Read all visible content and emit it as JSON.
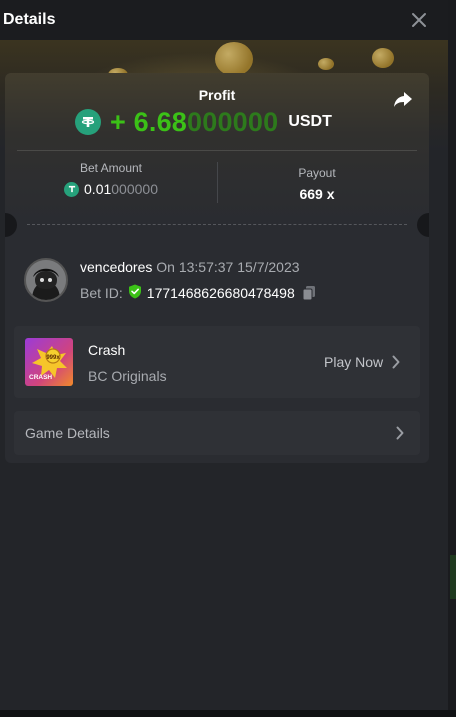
{
  "header": {
    "title": "Details"
  },
  "profit": {
    "label": "Profit",
    "sign": "+ ",
    "value_main": "6.68",
    "value_trailing": "000000",
    "currency": "USDT"
  },
  "bet": {
    "label": "Bet Amount",
    "value_main": "0.01",
    "value_trailing": "000000"
  },
  "payout": {
    "label": "Payout",
    "value": "669 x"
  },
  "user": {
    "name": "vencedores",
    "date": " On 13:57:37 15/7/2023",
    "bet_id_label": "Bet ID:",
    "bet_id": "1771468626680478498"
  },
  "game": {
    "name": "Crash",
    "provider": "BC Originals",
    "play_label": "Play Now",
    "thumb_caption": "CRASH"
  },
  "game_details": {
    "label": "Game Details"
  },
  "colors": {
    "profit_green": "#3bc117",
    "tether_green": "#26a17b",
    "panel_bg": "#232529",
    "card_bg": "#2a2c31"
  },
  "icons": [
    "close-icon",
    "tether-icon",
    "share-icon",
    "verified-shield-icon",
    "copy-icon",
    "chevron-right-icon"
  ]
}
